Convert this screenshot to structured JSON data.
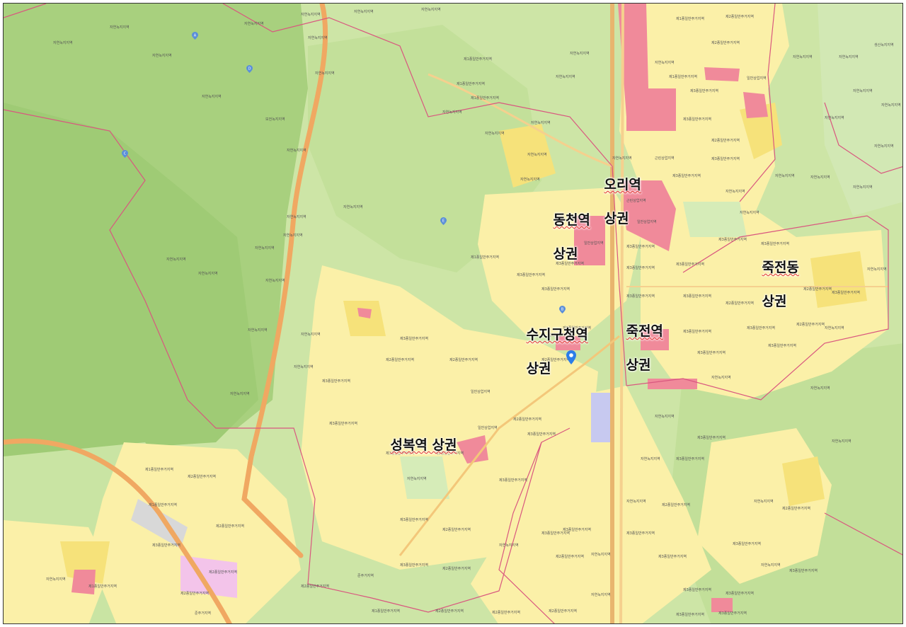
{
  "districts": [
    {
      "id": "ori",
      "name": "오리역",
      "suffix": "상권"
    },
    {
      "id": "dongcheon",
      "name": "동천역",
      "suffix": "상권"
    },
    {
      "id": "jukjeondong",
      "name": "죽전동",
      "suffix": "상권"
    },
    {
      "id": "suji",
      "name": "수지구청역",
      "suffix": "상권"
    },
    {
      "id": "jukjeon",
      "name": "죽전역",
      "suffix": "상권"
    },
    {
      "id": "seongbok",
      "name": "성복역 상권",
      "suffix": ""
    }
  ],
  "zone_labels": [
    "자연녹지지역",
    "제1종일반주거지역",
    "제2종일반주거지역",
    "제3종일반주거지역",
    "일반상업지역",
    "근린상업지역",
    "준주거지역",
    "보전녹지지역",
    "생산녹지지역"
  ],
  "poi_letters": [
    "A",
    "B",
    "C",
    "D",
    "E"
  ],
  "colors": {
    "forest_dark": "#a9d27f",
    "forest_light": "#c9e6a2",
    "residential": "#fbf0a8",
    "residential_strong": "#f6e27a",
    "commercial": "#f08a9a",
    "boundary": "#d9577f",
    "highway": "#f0a862",
    "park": "#d6ecb8",
    "marker": "#2b7de9"
  }
}
